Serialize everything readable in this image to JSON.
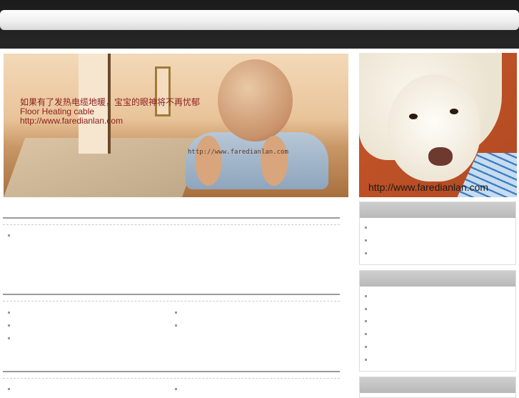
{
  "banner": {
    "caption_cn": "如果有了发热电缆地暖，宝宝的眼神将不再忧郁",
    "caption_en": "Floor Heating cable",
    "caption_url": "http://www.faredianlan.com",
    "watermark": "http://www.faredianlan.com"
  },
  "side_image": {
    "url_text": "http://www.faredianlan.com"
  }
}
